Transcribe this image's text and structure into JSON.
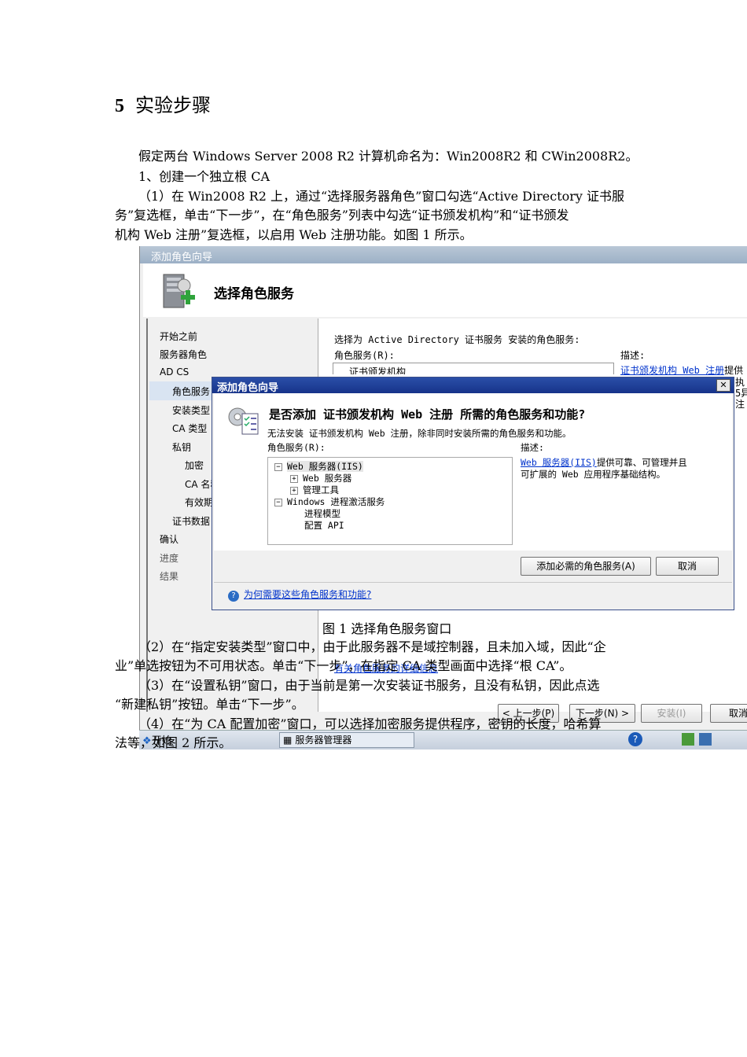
{
  "doc": {
    "heading_num": "5",
    "heading_text": "实验步骤",
    "p1": "假定两台 Windows Server 2008 R2 计算机命名为：Win2008R2 和 CWin2008R2。",
    "p2": "1、创建一个独立根 CA",
    "p3_line1": "（1）在 Win2008 R2 上，通过“选择服务器角色”窗口勾选“Active Directory 证书服",
    "p3_line2": "务”复选框，单击“下一步”，在“角色服务”列表中勾选“证书颁发机构”和“证书颁发",
    "p3_line3": "机构 Web 注册”复选框，以启用 Web 注册功能。如图 1 所示。",
    "caption": "图 1  选择角色服务窗口",
    "p4_line1": "（2）在“指定安装类型”窗口中，由于此服务器不是域控制器，且未加入域，因此“企",
    "p4_line2": "业”单选按钮为不可用状态。单击“下一步”，在指定 CA 类型画面中选择“根 CA”。",
    "p5_line1": "（3）在“设置私钥”窗口，由于当前是第一次安装证书服务，且没有私钥，因此点选",
    "p5_line2": "“新建私钥”按钮。单击“下一步”。",
    "p6_line1": "（4）在“为 CA 配置加密”窗口，可以选择加密服务提供程序，密钥的长度，哈希算",
    "p6_line2": "法等，如图 2 所示。"
  },
  "wizard": {
    "title": "添加角色向导",
    "page_title": "选择角色服务",
    "nav": [
      "开始之前",
      "服务器角色",
      "AD CS",
      "角色服务",
      "安装类型",
      "CA 类型",
      "私钥",
      "加密",
      "CA 名称",
      "有效期",
      "证书数据",
      "确认",
      "进度",
      "结果"
    ],
    "prompt": "选择为 Active Directory 证书服务 安装的角色服务:",
    "list_label": "角色服务(R):",
    "desc_label": "描述:",
    "desc_link": "证书颁发机构 Web 注册",
    "desc_tail": "提供",
    "desc_frag": [
      "执",
      "5异",
      "注"
    ],
    "list_item_partial": "证书颁发机构",
    "more_link": "有关角色服务的详细信息",
    "btn_prev": "< 上一步(P)",
    "btn_next": "下一步(N) >",
    "btn_install": "安装(I)",
    "btn_cancel": "取消"
  },
  "modal": {
    "title": "添加角色向导",
    "close": "✕",
    "question": "是否添加 证书颁发机构 Web 注册 所需的角色服务和功能?",
    "info": "无法安装 证书颁发机构 Web 注册，除非同时安装所需的角色服务和功能。",
    "tree_label": "角色服务(R):",
    "desc_label": "描述:",
    "desc_link": "Web 服务器(IIS)",
    "desc_line1_tail": "提供可靠、可管理并且",
    "desc_line2": "可扩展的 Web 应用程序基础结构。",
    "tree": [
      {
        "pm": "−",
        "text": "Web 服务器(IIS)"
      },
      {
        "pm": "+",
        "text": "Web 服务器"
      },
      {
        "pm": "+",
        "text": "管理工具"
      },
      {
        "pm": "−",
        "text": "Windows 进程激活服务"
      },
      {
        "pm": "",
        "text": "进程模型"
      },
      {
        "pm": "",
        "text": "配置 API"
      }
    ],
    "btn_add": "添加必需的角色服务(A)",
    "btn_cancel": "取消",
    "why_link": "为何需要这些角色服务和功能?"
  },
  "taskbar": {
    "start": "开始",
    "task": "服务器管理器"
  }
}
